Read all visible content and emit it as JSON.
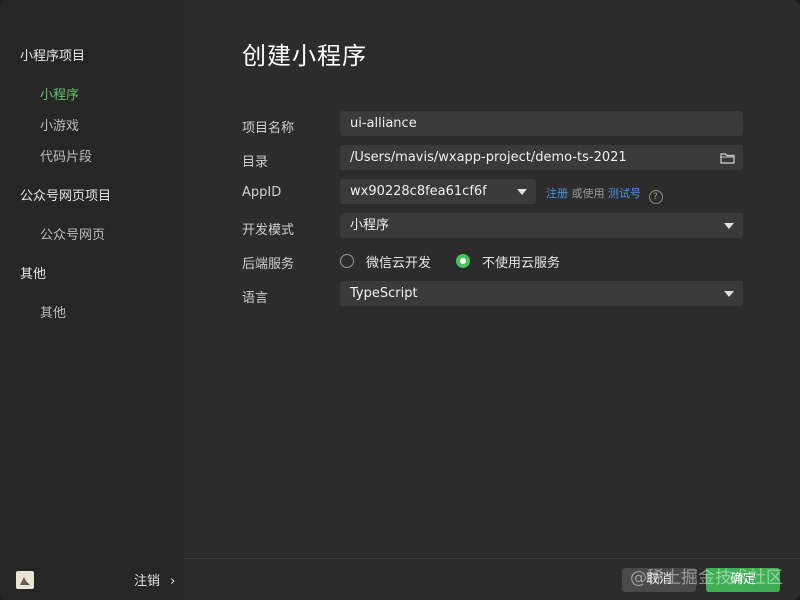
{
  "sidebar": {
    "sections": [
      {
        "title": "小程序项目",
        "items": [
          "小程序",
          "小游戏",
          "代码片段"
        ]
      },
      {
        "title": "公众号网页项目",
        "items": [
          "公众号网页"
        ]
      },
      {
        "title": "其他",
        "items": [
          "其他"
        ]
      }
    ],
    "logout_label": "注销",
    "logout_chevron": "›"
  },
  "main": {
    "title": "创建小程序",
    "form": {
      "project_name_label": "项目名称",
      "project_name_value": "ui-alliance",
      "directory_label": "目录",
      "directory_value": "/Users/mavis/wxapp-project/demo-ts-2021",
      "appid_label": "AppID",
      "appid_value": "wx90228c8fea61cf6f",
      "register_link": "注册",
      "or_use": "或使用",
      "test_account_link": "测试号",
      "help_glyph": "?",
      "dev_mode_label": "开发模式",
      "dev_mode_value": "小程序",
      "backend_label": "后端服务",
      "backend_option_cloud": "微信云开发",
      "backend_option_none": "不使用云服务",
      "backend_selected": "不使用云服务",
      "language_label": "语言",
      "language_value": "TypeScript"
    }
  },
  "footer": {
    "cancel_label": "取消",
    "confirm_label": "确定",
    "watermark": "@稀土掘金技术社区"
  },
  "colors": {
    "accent_green": "#3fae54",
    "link_blue": "#4e95e6",
    "active_green": "#5ec36a"
  }
}
